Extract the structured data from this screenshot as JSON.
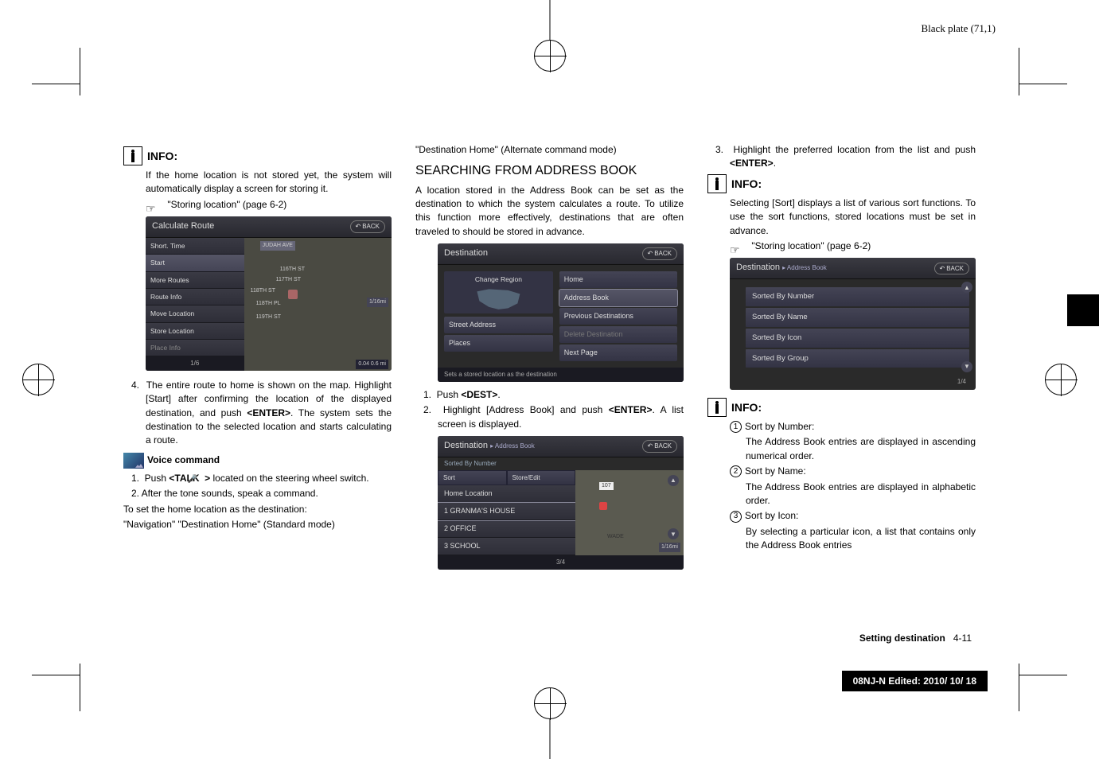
{
  "header": {
    "plate": "Black plate (71,1)"
  },
  "col1": {
    "info_label": "INFO:",
    "info_text": "If the home location is not stored yet, the system will automatically display a screen for storing it.",
    "ref1": "\"Storing location\" (page 6-2)",
    "ss1": {
      "title": "Calculate Route",
      "back": "BACK",
      "menu": [
        "Short. Time",
        "Start",
        "More Routes",
        "Route Info",
        "Move Location",
        "Store Location",
        "Place Info"
      ],
      "footer": "1/6",
      "map_labels": [
        "JUDAH AVE",
        "116TH ST",
        "117TH ST",
        "118TH ST",
        "118TH PL",
        "119TH ST"
      ],
      "map_dist": "0.04    0.6 mi",
      "map_scale": "1/16mi"
    },
    "step4": "4.  The entire route to home is shown on the map. Highlight [Start] after confirming the location of the displayed destination, and push <ENTER>. The system sets the destination to the selected location and starts calculating a route.",
    "voice_heading": "Voice command",
    "voice_step1_a": "1.  Push ",
    "voice_step1_talk": "<TALK ",
    "voice_step1_b": " > ",
    "voice_step1_c": "located on the steering wheel switch.",
    "voice_step2": "2.  After the tone sounds, speak a command.",
    "voice_set": "To set the home location as the destination:",
    "voice_cmd": "\"Navigation\" \"Destination Home\" (Standard mode)"
  },
  "col2": {
    "alt_cmd": "\"Destination Home\" (Alternate command mode)",
    "heading": "SEARCHING FROM ADDRESS BOOK",
    "desc": "A location stored in the Address Book can be set as the destination to which the system calculates a route. To utilize this function more effectively, destinations that are often traveled to should be stored in advance.",
    "ss2": {
      "title": "Destination",
      "back": "BACK",
      "change_region": "Change Region",
      "street": "Street Address",
      "places": "Places",
      "right": [
        "Home",
        "Address Book",
        "Previous Destinations",
        "Delete Destination",
        "Next Page"
      ],
      "footer": "Sets a stored location as the destination"
    },
    "step1": "1.  Push <DEST>.",
    "step2": "2.  Highlight [Address Book] and push <ENTER>. A list screen is displayed.",
    "ss3": {
      "title": "Destination",
      "sub": "Address Book",
      "back": "BACK",
      "sorted": "Sorted By Number",
      "sort": "Sort",
      "store": "Store/Edit",
      "items": [
        "Home Location",
        "1 GRANMA'S HOUSE",
        "2 OFFICE",
        "3 SCHOOL"
      ],
      "footer": "3/4",
      "map_labels": [
        "107",
        "WADE",
        "1/16mi"
      ]
    }
  },
  "col3": {
    "step3": "3.  Highlight the preferred location from the list and push <ENTER>.",
    "info_label": "INFO:",
    "info_text": "Selecting [Sort] displays a list of various sort functions. To use the sort functions, stored locations must be set in advance.",
    "ref": "\"Storing location\" (page 6-2)",
    "ss4": {
      "title": "Destination",
      "sub": "Address Book",
      "back": "BACK",
      "items": [
        "Sorted By Number",
        "Sorted By Name",
        "Sorted By Icon",
        "Sorted By Group"
      ],
      "footer": "1/4"
    },
    "info_label2": "INFO:",
    "s1_t": "Sort by Number:",
    "s1_d": "The Address Book entries are displayed in ascending numerical order.",
    "s2_t": "Sort by Name:",
    "s2_d": "The Address Book entries are displayed in alphabetic order.",
    "s3_t": "Sort by Icon:",
    "s3_d": "By selecting a particular icon, a list that contains only the Address Book entries"
  },
  "footer": {
    "section": "Setting destination",
    "page": "4-11",
    "edit": "08NJ-N Edited:  2010/ 10/ 18"
  }
}
